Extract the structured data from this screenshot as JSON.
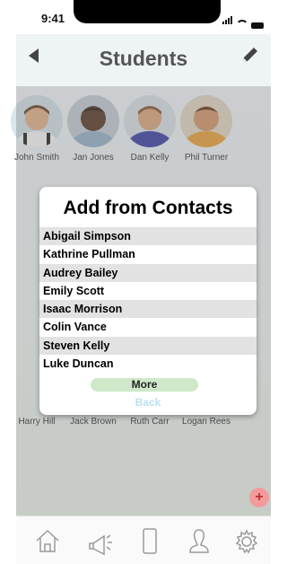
{
  "status_bar": {
    "time": "9:41"
  },
  "header": {
    "title": "Students"
  },
  "students_top": [
    {
      "name": "John Smith"
    },
    {
      "name": "Jan Jones"
    },
    {
      "name": "Dan Kelly"
    },
    {
      "name": "Phil Turner"
    }
  ],
  "students_bottom": [
    {
      "name": "Harry Hill"
    },
    {
      "name": "Jack Brown"
    },
    {
      "name": "Ruth Carr"
    },
    {
      "name": "Logan Rees"
    }
  ],
  "dialog": {
    "title": "Add from Contacts",
    "contacts": [
      "Abigail Simpson",
      "Kathrine Pullman",
      "Audrey Bailey",
      "Emily Scott",
      "Isaac Morrison",
      "Colin Vance",
      "Steven Kelly",
      "Luke Duncan"
    ],
    "more_label": "More",
    "back_label": "Back"
  },
  "fab": {
    "label": "+"
  },
  "colors": {
    "header_bg": "#eef3f6",
    "more_bg": "#cfe8c9",
    "back_text": "#bcdff0",
    "fab_bg": "#f39a9a",
    "row_alt": "#e2e2e2"
  },
  "tabs": [
    {
      "icon": "home-icon"
    },
    {
      "icon": "megaphone-icon"
    },
    {
      "icon": "phone-icon"
    },
    {
      "icon": "person-icon"
    },
    {
      "icon": "gear-icon"
    }
  ]
}
